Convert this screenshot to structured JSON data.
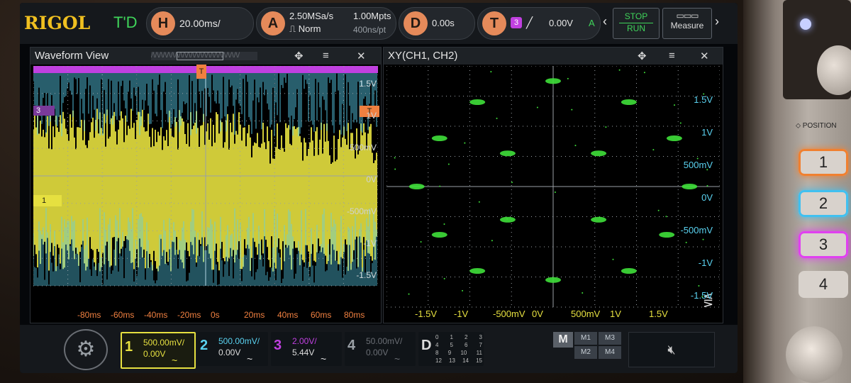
{
  "brand": "RIGOL",
  "run_state": "T'D",
  "horizontal": {
    "key": "H",
    "scale": "20.00ms/"
  },
  "acquire": {
    "key": "A",
    "sample_rate": "2.50MSa/s",
    "mode": "Norm",
    "memory": "1.00Mpts",
    "time_per_point": "400ns/pt"
  },
  "delay": {
    "key": "D",
    "value": "0.00s"
  },
  "trigger": {
    "key": "T",
    "source": "3",
    "level": "0.00V",
    "mode": "A"
  },
  "stop_run": {
    "stop": "STOP",
    "run": "RUN"
  },
  "measure": "Measure",
  "colors": {
    "ch1": "#e6e040",
    "ch2": "#5ad2f0",
    "ch3": "#c040e0",
    "ch4": "#9aa0a6",
    "trigger": "#f08040",
    "grid": "#3b3f44"
  },
  "waveform_view": {
    "title": "Waveform View",
    "marker_trigger": "T",
    "marker_ch3": "3",
    "marker_ch1": "1",
    "y_labels": [
      "1.5V",
      "1V",
      "500mV",
      "0V",
      "-500mV",
      "-1V",
      "-1.5V"
    ],
    "x_labels": [
      "-80ms",
      "-60ms",
      "-40ms",
      "-20ms",
      "0s",
      "20ms",
      "40ms",
      "60ms",
      "80ms"
    ]
  },
  "xy_view": {
    "title": "XY(CH1, CH2)",
    "y_labels": [
      "1.5V",
      "1V",
      "500mV",
      "0V",
      "-500mV",
      "-1V",
      "-1.5V"
    ],
    "x_labels": [
      "-1.5V",
      "-1V",
      "-500mV",
      "0V",
      "500mV",
      "1V",
      "1.5V"
    ]
  },
  "channels": [
    {
      "num": "1",
      "scale": "500.00mV/",
      "offset": "0.00V",
      "coupling": "~"
    },
    {
      "num": "2",
      "scale": "500.00mV/",
      "offset": "0.00V",
      "coupling": "~"
    },
    {
      "num": "3",
      "scale": "2.00V/",
      "offset": "5.44V",
      "coupling": "~"
    },
    {
      "num": "4",
      "scale": "50.00mV/",
      "offset": "0.00V",
      "coupling": "~"
    }
  ],
  "digital": {
    "label": "D",
    "rows": [
      [
        "0",
        "1",
        "2",
        "3"
      ],
      [
        "4",
        "5",
        "6",
        "7"
      ],
      [
        "8",
        "9",
        "10",
        "11"
      ],
      [
        "12",
        "13",
        "14",
        "15"
      ]
    ]
  },
  "math": {
    "label": "M",
    "items": [
      "M1",
      "M3",
      "M2",
      "M4"
    ]
  },
  "side_panel": {
    "position_label": "POSITION",
    "buttons": [
      "1",
      "2",
      "3",
      "4"
    ]
  }
}
